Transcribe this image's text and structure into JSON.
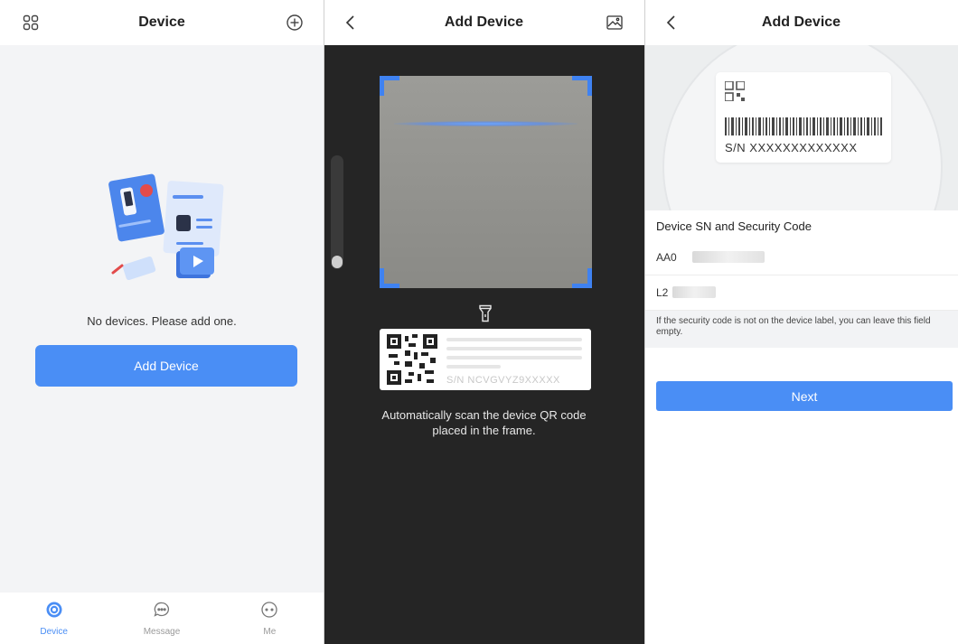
{
  "screen1": {
    "title": "Device",
    "empty_text": "No devices. Please add one.",
    "add_button": "Add Device",
    "tabs": [
      {
        "label": "Device",
        "icon": "device-icon",
        "active": true
      },
      {
        "label": "Message",
        "icon": "message-icon",
        "active": false
      },
      {
        "label": "Me",
        "icon": "me-icon",
        "active": false
      }
    ]
  },
  "screen2": {
    "title": "Add Device",
    "qr_sn": "S/N  NCVGVYZ9XXXXX",
    "hint": "Automatically scan the device QR code placed in the frame."
  },
  "screen3": {
    "title": "Add Device",
    "label_sn": "S/N  XXXXXXXXXXXXX",
    "section_title": "Device SN and Security Code",
    "sn_value": "AA0",
    "code_value": "L2",
    "hint": "If the security code is not on the device label, you can leave this field empty.",
    "next_button": "Next"
  },
  "colors": {
    "accent": "#4a8ef5",
    "scanner_bg": "#252525",
    "frame_corner": "#3f82f1"
  }
}
